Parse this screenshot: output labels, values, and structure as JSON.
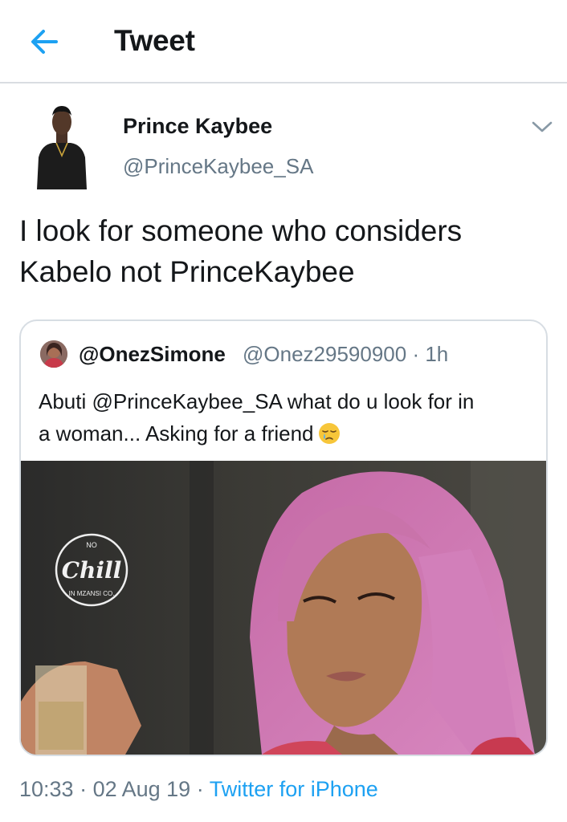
{
  "header": {
    "title": "Tweet",
    "back_icon": "arrow-left-icon",
    "accent": "#1da1f2"
  },
  "tweet": {
    "author_name": "Prince Kaybee",
    "author_handle": "@PrinceKaybee_SA",
    "text": "I look for someone who considers Kabelo not PrinceKaybee",
    "time": "10:33",
    "date": "02 Aug 19",
    "source": "Twitter for iPhone"
  },
  "quoted": {
    "author_name": "@OnezSimone",
    "author_handle": "@Onez29590900",
    "age": "1h",
    "text_line1": "Abuti @PrinceKaybee_SA what do u look for in",
    "text_line2": "a woman... Asking for a friend",
    "emoji": "sleepy-face-emoji",
    "image_logo_top": "NO",
    "image_logo_main": "Chill",
    "image_logo_bottom": "IN MZANSI CO."
  },
  "colors": {
    "text": "#14171a",
    "secondary": "#657786",
    "link": "#1da1f2",
    "border": "#d7dde3"
  }
}
